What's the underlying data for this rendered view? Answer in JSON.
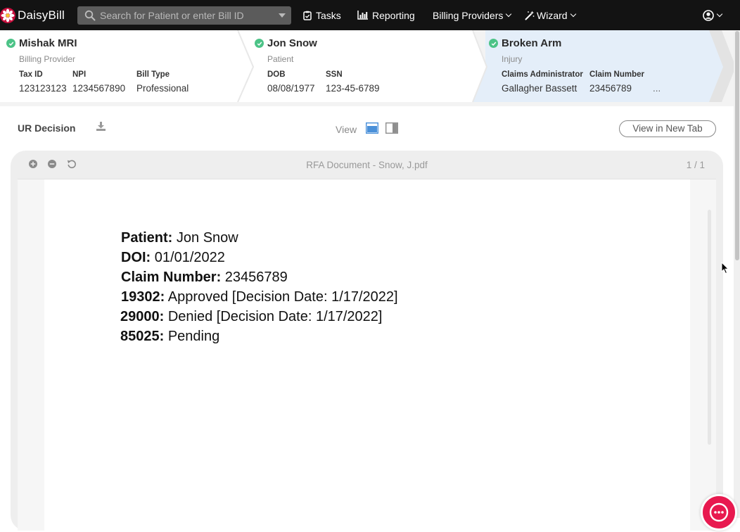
{
  "app": {
    "brand": "DaisyBill",
    "search_placeholder": "Search for Patient or enter Bill ID"
  },
  "nav": {
    "tasks": "Tasks",
    "reporting": "Reporting",
    "billing_providers": "Billing Providers",
    "wizard": "Wizard"
  },
  "breadcrumb": [
    {
      "title": "Mishak MRI",
      "subtitle": "Billing Provider",
      "fields": [
        {
          "label": "Tax ID",
          "value": "123123123"
        },
        {
          "label": "NPI",
          "value": "1234567890"
        },
        {
          "label": "Bill Type",
          "value": "Professional"
        }
      ]
    },
    {
      "title": "Jon Snow",
      "subtitle": "Patient",
      "fields": [
        {
          "label": "DOB",
          "value": "08/08/1977"
        },
        {
          "label": "SSN",
          "value": "123-45-6789"
        }
      ]
    },
    {
      "title": "Broken Arm",
      "subtitle": "Injury",
      "fields": [
        {
          "label": "Claims Administrator",
          "value": "Gallagher Bassett"
        },
        {
          "label": "Claim Number",
          "value": "23456789"
        }
      ],
      "more": "..."
    }
  ],
  "toolbar": {
    "title": "UR Decision",
    "view_label": "View",
    "new_tab_label": "View in New Tab"
  },
  "viewer": {
    "document_name": "RFA Document - Snow, J.pdf",
    "page_count": "1 / 1"
  },
  "document": {
    "lines": [
      {
        "label": "Patient:",
        "text": " Jon Snow"
      },
      {
        "label": "DOI:",
        "text": " 01/01/2022"
      },
      {
        "label": "Claim Number:",
        "text": " 23456789"
      },
      {
        "label": "19302:",
        "text": " Approved [Decision Date: 1/17/2022]"
      },
      {
        "label": "29000:",
        "text": " Denied [Decision Date: 1/17/2022]"
      },
      {
        "label": "85025:",
        "text": " Pending"
      }
    ]
  },
  "colors": {
    "nav_bg": "#131313",
    "check_green": "#4cc387",
    "active_panel": "#e3eefa",
    "chat_red": "#e8194f",
    "view_active": "#4a90d9"
  }
}
